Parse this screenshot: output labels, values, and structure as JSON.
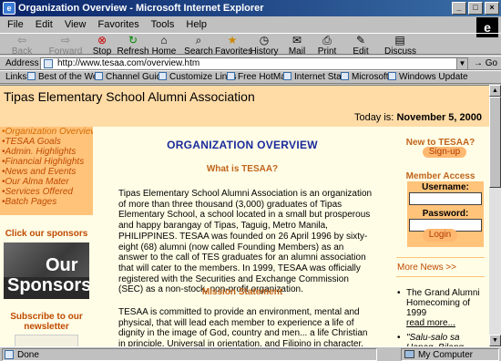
{
  "window": {
    "title": "Organization Overview - Microsoft Internet Explorer"
  },
  "menu": [
    "File",
    "Edit",
    "View",
    "Favorites",
    "Tools",
    "Help"
  ],
  "toolbar": {
    "back": "Back",
    "forward": "Forward",
    "stop": "Stop",
    "refresh": "Refresh",
    "home": "Home",
    "search": "Search",
    "favorites": "Favorites",
    "history": "History",
    "mail": "Mail",
    "print": "Print",
    "edit": "Edit",
    "discuss": "Discuss"
  },
  "address": {
    "label": "Address",
    "url": "http://www.tesaa.com/overview.htm",
    "go": "Go"
  },
  "links": {
    "label": "Links",
    "items": [
      "Best of the Web",
      "Channel Guide",
      "Customize Links",
      "Free HotMail",
      "Internet Start",
      "Microsoft",
      "Windows Update"
    ]
  },
  "page": {
    "site_title": "Tipas Elementary School Alumni Association",
    "today_label": "Today is:",
    "today_date": "November 5, 2000",
    "nav": [
      "•Organization Overview",
      "•TESAA Goals",
      "•Admin. Highlights",
      "•Financial Highlights",
      "•News and Events",
      "•Our Alma Mater",
      "•Services Offered",
      "•Batch Pages"
    ],
    "sponsors_header": "Click our sponsors",
    "sponsors_banner_1": "Our",
    "sponsors_banner_2": "Sponsors",
    "newsletter_header": "Subscribe to our newsletter",
    "heading": "ORGANIZATION OVERVIEW",
    "what_heading": "What is TESAA?",
    "what_text": "Tipas Elementary School Alumni Association is an organization of more than three thousand (3,000) graduates of Tipas Elementary School, a school located in a small but prosperous and happy barangay of Tipas, Taguig, Metro Manila, PHILIPPINES. TESAA was founded on 26 April 1996 by sixty-eight (68) alumni (now called Founding Members) as an answer to the call of TES graduates for an alumni association that will cater to the members. In 1999, TESAA was officially registered with the Securities and Exchange Commission (SEC) as a non-stock, non-profit organization.",
    "mission_heading": "Mission Statement",
    "mission_text": "TESAA is committed to provide an environment, mental and physical, that will lead each member to experience a life of dignity in the image of God, country and men... a life Christian in principle, Universal in orientation, and Filipino in character.",
    "new_to": "New to TESAA?",
    "signup": "Sign-up",
    "member_access": "Member Access",
    "username_label": "Username:",
    "password_label": "Password:",
    "login": "Login",
    "more_news": "More News >>",
    "news_1": "The Grand Alumni Homecoming of 1999",
    "read_more": "read more...",
    "news_2": "\"Salu-salo sa Hapag, Bilang Pasasalamat\""
  },
  "status": {
    "text": "Done",
    "zone": "My Computer"
  }
}
